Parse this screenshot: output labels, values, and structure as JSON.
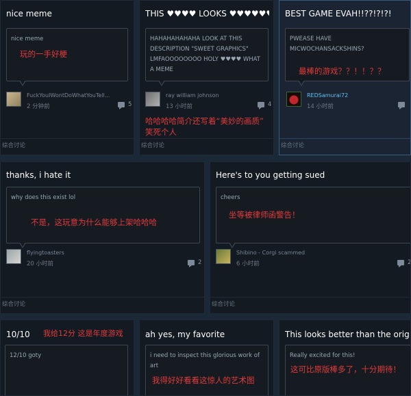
{
  "section_label": "综合讨论",
  "cards": [
    {
      "title": "nice meme",
      "body": "nice meme",
      "annotation": "玩的一手好梗",
      "author": "FuckYouIWontDoWhatYouTell...",
      "time": "2 分钟前",
      "comments": "5"
    },
    {
      "title": "THIS ♥♥♥♥ LOOKS ♥♥♥♥♥♥♥♥",
      "body": "HAHAHAHAHAHA LOOK AT THIS DESCRIPTION \"SWEET GRAPHICS\" LMFAOOOOOOOO HOLY ♥♥♥♥ WHAT A MEME",
      "annotation_line1": "哈哈哈哈简介还写着“美妙的画质”",
      "annotation_line2": "笑死个人",
      "author": "ray william johnson",
      "time": "13 小时前",
      "comments": "4"
    },
    {
      "title": "BEST GAME EVAH!!??!?!?!",
      "body": "PWEASE HAVE MICWOCHANSACKSHINS?",
      "annotation": "最棒的游戏？？！！？？",
      "author": "REDSamurai72",
      "time": "14 小时前",
      "comments": ""
    },
    {
      "title": "thanks, i hate it",
      "body": "why does this exist lol",
      "annotation": "不是，这玩意为什么能够上架哈哈哈",
      "author": "flyingtoasters",
      "time": "20 小时前",
      "comments": "2"
    },
    {
      "title": "Here's to you getting sued",
      "body": "cheers",
      "annotation": "坐等被律师函警告！",
      "author": "Shibino - Corgi scammed",
      "time": "6 小时前",
      "comments": "2"
    },
    {
      "title": "10/10",
      "body": "12/10 goty",
      "annotation": "我给12分  这是年度游戏"
    },
    {
      "title": "ah yes, my favorite",
      "body": "i need to inspect this glorious work of art",
      "annotation": "我得好好看看这惊人的艺术图"
    },
    {
      "title": "This looks better than the original",
      "body": "Really excited for this!",
      "annotation": "这可比原版棒多了，十分期待！"
    }
  ]
}
